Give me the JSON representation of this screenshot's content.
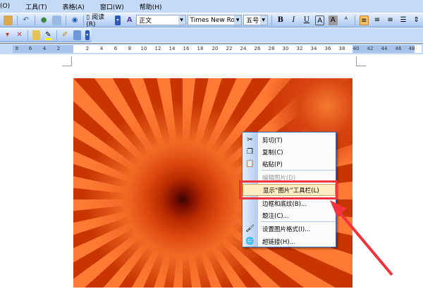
{
  "menubar": {
    "items": [
      "(O)",
      "工具(T)",
      "表格(A)",
      "窗口(W)",
      "帮助(H)"
    ]
  },
  "toolbar": {
    "read_label": "阅读(R)",
    "style": "正文",
    "font": "Times New Roman",
    "size": "五号"
  },
  "ruler": {
    "ticks": [
      "8",
      "6",
      "4",
      "2",
      "2",
      "4",
      "6",
      "8",
      "10",
      "12",
      "14",
      "16",
      "18",
      "20",
      "22",
      "24",
      "26",
      "28",
      "30",
      "32",
      "34",
      "36",
      "38",
      "40",
      "42",
      "44",
      "46",
      "48"
    ]
  },
  "context_menu": {
    "items": [
      {
        "label": "剪切(T)",
        "icon": "scissors-icon",
        "enabled": true
      },
      {
        "label": "复制(C)",
        "icon": "copy-icon",
        "enabled": true
      },
      {
        "label": "粘贴(P)",
        "icon": "paste-icon",
        "enabled": true
      },
      {
        "label": "编辑图片(D)",
        "icon": "",
        "enabled": false
      },
      {
        "label": "显示“图片”工具栏(L)",
        "icon": "",
        "enabled": true,
        "highlighted": true
      },
      {
        "label": "边框和底纹(B)...",
        "icon": "",
        "enabled": true
      },
      {
        "label": "题注(C)...",
        "icon": "",
        "enabled": true
      },
      {
        "label": "设置图片格式(I)...",
        "icon": "format-picture-icon",
        "enabled": true
      },
      {
        "label": "超链接(H)...",
        "icon": "hyperlink-icon",
        "enabled": true
      }
    ]
  },
  "colors": {
    "annotation": "#f2333b",
    "highlight": "#ffeec2"
  }
}
